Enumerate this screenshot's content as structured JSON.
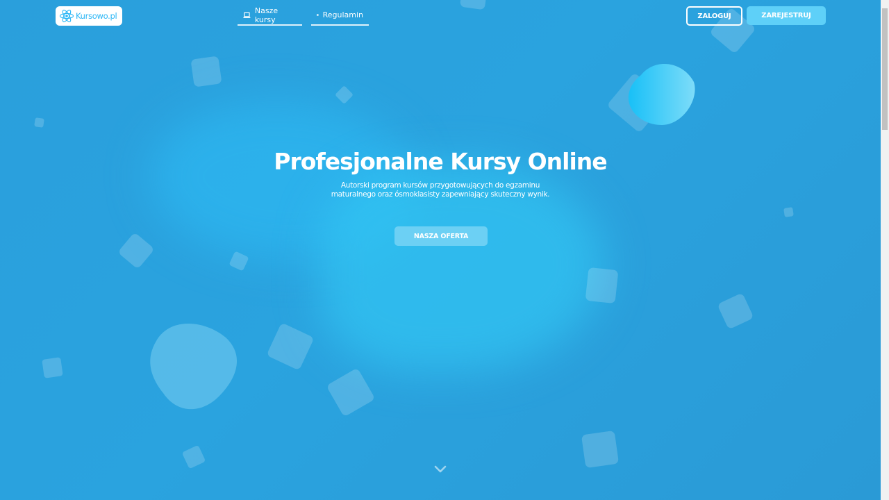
{
  "brand": {
    "name": "Kursowo.pl",
    "icon": "atom-icon",
    "color": "#29b6f6"
  },
  "nav": {
    "links": [
      {
        "label": "Nasze kursy",
        "icon": "laptop-icon"
      },
      {
        "label": "Regulamin",
        "icon": "document-icon"
      }
    ],
    "login_label": "ZALOGUJ",
    "register_label": "ZAREJESTRUJ"
  },
  "hero": {
    "title": "Profesjonalne Kursy Online",
    "subtitle_line1": "Autorski program kursów przygotowujących do egzaminu",
    "subtitle_line2": "maturalnego oraz ósmoklasisty zapewniający skuteczny wynik.",
    "cta_label": "NASZA OFERTA",
    "scroll_icon": "chevron-down-icon"
  },
  "colors": {
    "background": "#2a9fdc",
    "accent": "#5ed0f8",
    "text": "#ffffff"
  }
}
